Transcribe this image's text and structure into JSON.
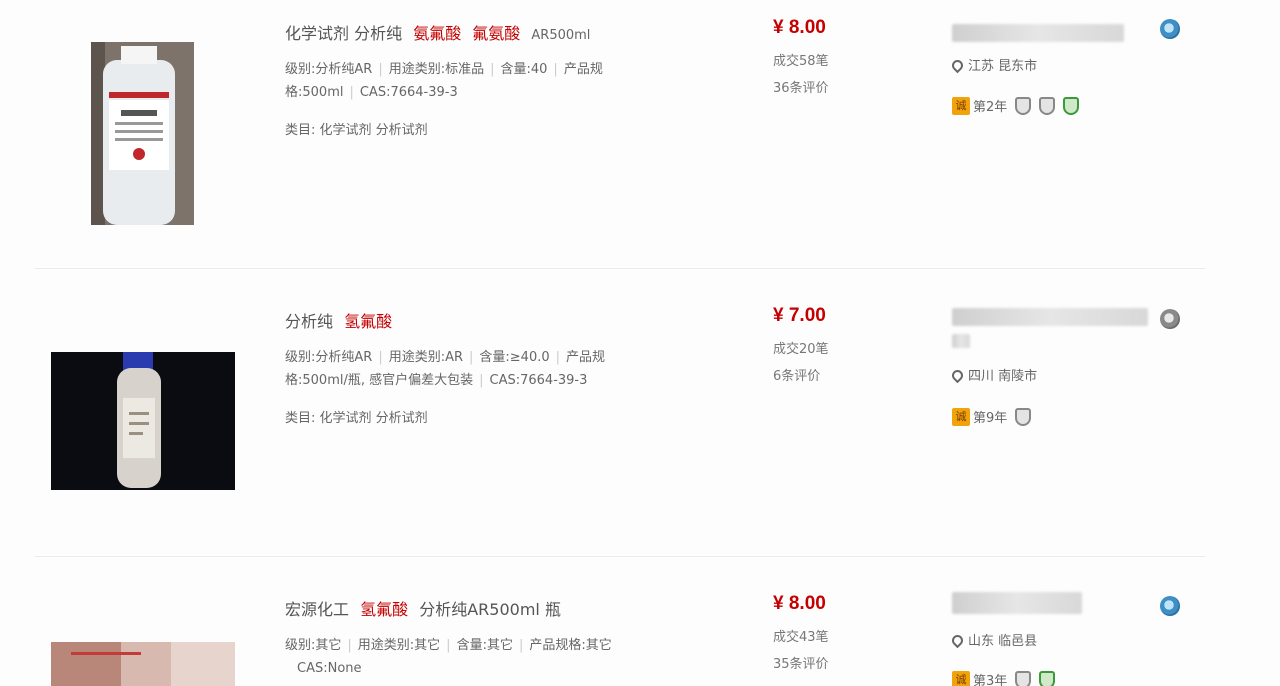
{
  "colors": {
    "accent_price": "#c40000",
    "keyword": "#c40000",
    "badge": "#f1a30b"
  },
  "items": [
    {
      "title_prefix": "化学试剂 分析纯",
      "title_kw1": "氨氟酸",
      "title_kw2": "氟氨酸",
      "title_tail": "AR500ml",
      "attr_line1": [
        "级别:分析纯AR",
        "用途类别:标准品",
        "含量:40",
        "产品规"
      ],
      "attr_line2": [
        "格:500ml",
        "CAS:7664-39-3"
      ],
      "category": "类目: 化学试剂 分析试剂",
      "price": "¥ 8.00",
      "sold": "成交58笔",
      "reviews": "36条评价",
      "location": "江苏 昆东市",
      "seller_years": "第2年",
      "cheng_label": "诚",
      "icons": [
        "wangwang-icon",
        "shield-icon",
        "shield-icon",
        "shield-green-icon"
      ]
    },
    {
      "title_prefix": "分析纯",
      "title_kw1": "氢氟酸",
      "title_kw2": "",
      "title_tail": "",
      "attr_line1": [
        "级别:分析纯AR",
        "用途类别:AR",
        "含量:≥40.0",
        "产品规"
      ],
      "attr_line2": [
        "格:500ml/瓶, 感官户偏差大包装",
        "CAS:7664-39-3"
      ],
      "category": "类目: 化学试剂 分析试剂",
      "price": "¥ 7.00",
      "sold": "成交20笔",
      "reviews": "6条评价",
      "location": "四川 南陵市",
      "seller_years": "第9年",
      "cheng_label": "诚",
      "icons": [
        "wangwang-icon",
        "shield-icon"
      ]
    },
    {
      "title_prefix": "宏源化工",
      "title_kw1": "氢氟酸",
      "title_kw2": "",
      "title_tail": "分析纯AR500ml 瓶",
      "attr_line1": [
        "级别:其它",
        "用途类别:其它",
        "含量:其它",
        "产品规格:其它"
      ],
      "attr_line2": [
        "CAS:None"
      ],
      "category": "",
      "price": "¥ 8.00",
      "sold": "成交43笔",
      "reviews": "35条评价",
      "location": "山东 临邑县",
      "seller_years": "第3年",
      "cheng_label": "诚",
      "icons": [
        "wangwang-icon",
        "shield-icon",
        "shield-green-icon"
      ]
    }
  ]
}
